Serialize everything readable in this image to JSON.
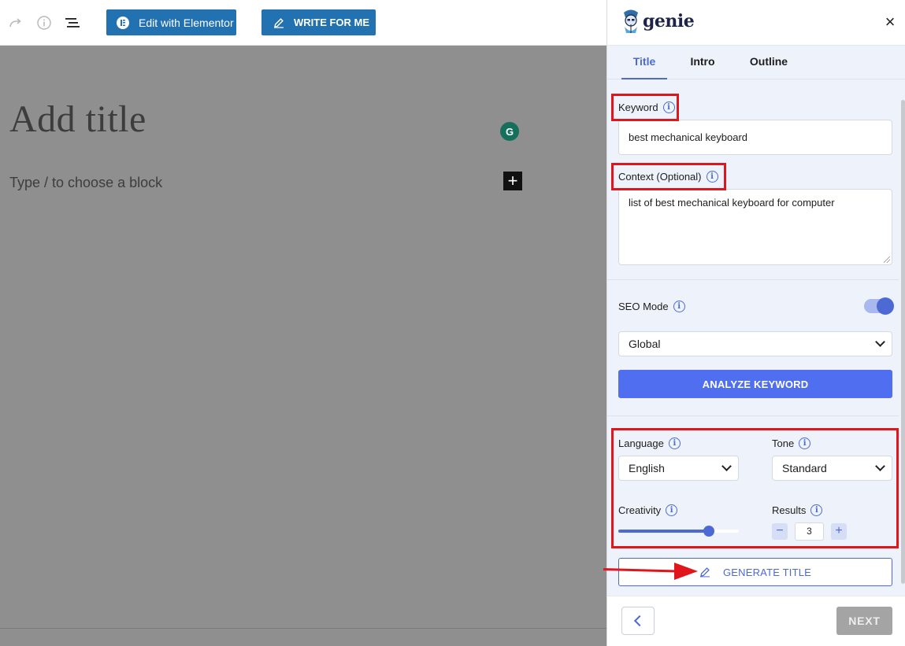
{
  "toolbar": {
    "elementor_label": "Edit with Elementor",
    "write_label": "WRITE FOR ME",
    "redo_icon": "redo-icon",
    "details_icon": "info-icon",
    "list_view_icon": "list-view-icon"
  },
  "editor": {
    "title_placeholder": "Add title",
    "block_placeholder": "Type / to choose a block",
    "grammarly_letter": "G",
    "add_block_symbol": "+"
  },
  "panel": {
    "brand": "genie",
    "close_symbol": "×",
    "tabs": [
      {
        "label": "Title",
        "active": true
      },
      {
        "label": "Intro",
        "active": false
      },
      {
        "label": "Outline",
        "active": false
      }
    ],
    "keyword": {
      "label": "Keyword",
      "value": "best mechanical keyboard"
    },
    "context": {
      "label": "Context (Optional)",
      "value": "list of best mechanical keyboard for computer"
    },
    "seo": {
      "label": "SEO Mode",
      "enabled": true,
      "region": "Global"
    },
    "analyze_label": "ANALYZE KEYWORD",
    "language": {
      "label": "Language",
      "value": "English"
    },
    "tone": {
      "label": "Tone",
      "value": "Standard"
    },
    "creativity": {
      "label": "Creativity",
      "level": 0.75
    },
    "results": {
      "label": "Results",
      "value": "3",
      "minus": "−",
      "plus": "+"
    },
    "generate_label": "GENERATE TITLE",
    "next_label": "NEXT"
  },
  "colors": {
    "accent": "#4d6ad4",
    "primary_button": "#4f6ef0",
    "wp_blue": "#2271b1",
    "annotation_red": "#e0161c"
  }
}
